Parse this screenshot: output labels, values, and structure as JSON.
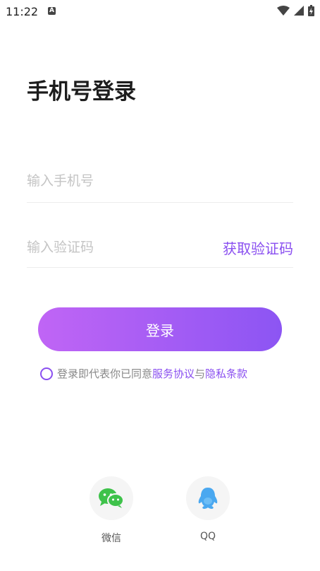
{
  "status_bar": {
    "time": "11:22",
    "a_badge": "A"
  },
  "page": {
    "title": "手机号登录"
  },
  "phone": {
    "placeholder": "输入手机号",
    "value": ""
  },
  "code": {
    "placeholder": "输入验证码",
    "value": "",
    "get_code_label": "获取验证码"
  },
  "login": {
    "label": "登录"
  },
  "agreement": {
    "prefix": "登录即代表你已同意",
    "service_link": "服务协议",
    "conjunction": "与",
    "privacy_link": "隐私条款",
    "checked": false
  },
  "social": {
    "wechat_label": "微信",
    "qq_label": "QQ"
  },
  "colors": {
    "accent": "#8a4ff0",
    "gradient_start": "#c065f5",
    "gradient_end": "#8c55f3",
    "wechat_green": "#3ec24a",
    "qq_blue": "#4aa8f0"
  }
}
